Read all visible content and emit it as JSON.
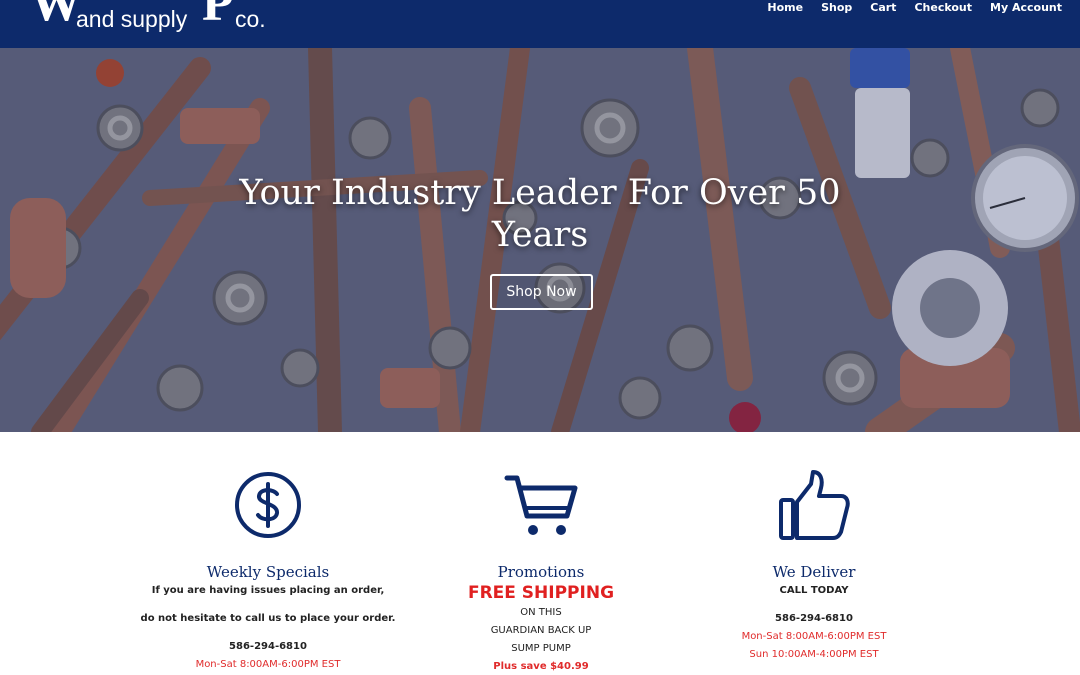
{
  "header": {
    "logo": {
      "letter_w": "W",
      "letter_p": "P",
      "line1": "and supply",
      "line2": "co."
    },
    "nav": [
      "Home",
      "Shop",
      "Cart",
      "Checkout",
      "My Account"
    ],
    "background_color": "#0d2a6b"
  },
  "hero": {
    "title": "Your Industry Leader For Over 50 Years",
    "button_label": "Shop Now"
  },
  "features": [
    {
      "icon": "dollar-circle-icon",
      "title": "Weekly Specials",
      "lines": [
        "If you are having issues placing an order,",
        "do not hesitate to call us to place your order.",
        "586-294-6810",
        "Mon-Sat 8:00AM-6:00PM EST"
      ]
    },
    {
      "icon": "cart-icon",
      "title": "Promotions",
      "highlight": "FREE SHIPPING",
      "lines": [
        "ON THIS",
        "GUARDIAN BACK UP",
        "SUMP PUMP",
        "Plus save $40.99"
      ]
    },
    {
      "icon": "thumbs-up-icon",
      "title": "We Deliver",
      "lines": [
        "CALL TODAY",
        "586-294-6810",
        "Mon-Sat 8:00AM-6:00PM EST",
        "Sun 10:00AM-4:00PM EST"
      ]
    }
  ],
  "colors": {
    "brand_blue": "#0d2a6b",
    "accent_red": "#e02b2b"
  }
}
